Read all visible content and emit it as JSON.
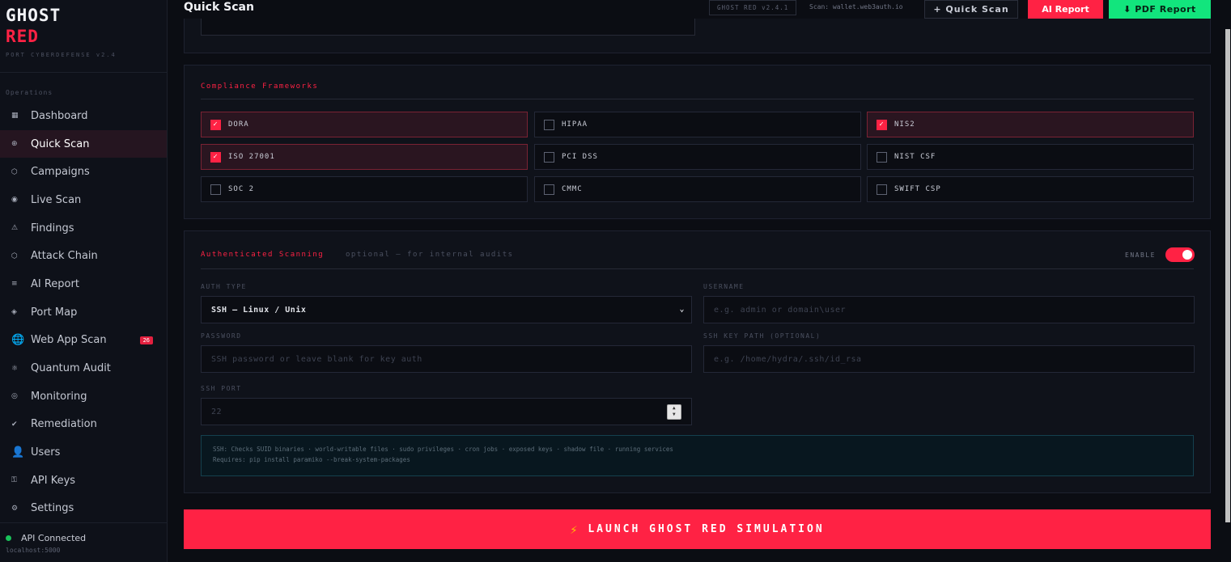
{
  "brand": {
    "line1": "GHOST",
    "line2": "RED",
    "subtitle": "PORT CYBERDEFENSE v2.4"
  },
  "sidebar": {
    "section": "Operations",
    "items": [
      {
        "label": "Dashboard",
        "icon": "grid-icon",
        "glyph": "▦"
      },
      {
        "label": "Quick Scan",
        "icon": "crosshair-icon",
        "glyph": "⊕"
      },
      {
        "label": "Campaigns",
        "icon": "hexagon-icon",
        "glyph": "⬡"
      },
      {
        "label": "Live Scan",
        "icon": "radar-icon",
        "glyph": "◉"
      },
      {
        "label": "Findings",
        "icon": "warning-icon",
        "glyph": "⚠"
      },
      {
        "label": "Attack Chain",
        "icon": "chain-icon",
        "glyph": "⬡"
      },
      {
        "label": "AI Report",
        "icon": "list-icon",
        "glyph": "≡"
      },
      {
        "label": "Port Map",
        "icon": "diamond-icon",
        "glyph": "◈"
      },
      {
        "label": "Web App Scan",
        "icon": "globe-icon",
        "glyph": "🌐",
        "badge": "26"
      },
      {
        "label": "Quantum Audit",
        "icon": "atom-icon",
        "glyph": "⚛"
      },
      {
        "label": "Monitoring",
        "icon": "monitor-icon",
        "glyph": "◎"
      },
      {
        "label": "Remediation",
        "icon": "check-icon",
        "glyph": "✔"
      },
      {
        "label": "Users",
        "icon": "user-icon",
        "glyph": "👤"
      },
      {
        "label": "API Keys",
        "icon": "key-icon",
        "glyph": "⚿"
      },
      {
        "label": "Settings",
        "icon": "gear-icon",
        "glyph": "⚙"
      }
    ],
    "active_index": 1,
    "api_status": "API Connected",
    "api_host": "localhost:5000"
  },
  "header": {
    "title": "Quick Scan",
    "version": "GHOST RED v2.4.1",
    "scan_target": "Scan: wallet.web3auth.io",
    "quick_scan_label": "+ Quick Scan",
    "ai_report_label": "AI Report",
    "pdf_report_label": "⬇ PDF Report"
  },
  "compliance": {
    "title": "Compliance Frameworks",
    "frameworks": [
      {
        "label": "DORA",
        "checked": true
      },
      {
        "label": "HIPAA",
        "checked": false
      },
      {
        "label": "NIS2",
        "checked": true
      },
      {
        "label": "ISO 27001",
        "checked": true
      },
      {
        "label": "PCI DSS",
        "checked": false
      },
      {
        "label": "NIST CSF",
        "checked": false
      },
      {
        "label": "SOC 2",
        "checked": false
      },
      {
        "label": "CMMC",
        "checked": false
      },
      {
        "label": "SWIFT CSP",
        "checked": false
      }
    ]
  },
  "auth": {
    "title": "Authenticated Scanning",
    "note": "optional — for internal audits",
    "enable_label": "ENABLE",
    "enabled": true,
    "auth_type_label": "AUTH TYPE",
    "auth_type_value": "SSH — Linux / Unix",
    "username_label": "USERNAME",
    "username_placeholder": "e.g. admin or domain\\user",
    "password_label": "PASSWORD",
    "password_placeholder": "SSH password or leave blank for key auth",
    "keypath_label": "SSH KEY PATH (OPTIONAL)",
    "keypath_placeholder": "e.g. /home/hydra/.ssh/id_rsa",
    "port_label": "SSH PORT",
    "port_placeholder": "22",
    "info_line1": "SSH: Checks SUID binaries · world-writable files · sudo privileges · cron jobs · exposed keys · shadow file · running services",
    "info_line2": "Requires: pip install paramiko --break-system-packages"
  },
  "launch_label": "LAUNCH GHOST RED SIMULATION",
  "launch_glyph": "⚡",
  "colors": {
    "accent": "#ff2244",
    "success": "#12e57d",
    "bg": "#0b0d13"
  }
}
